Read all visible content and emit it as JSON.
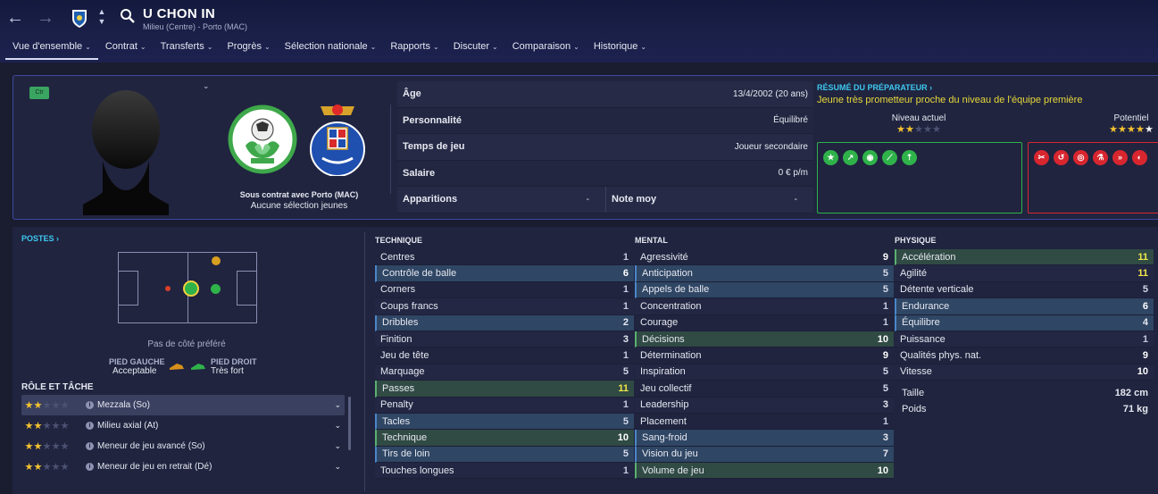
{
  "player": {
    "name": "U CHON IN",
    "subtitle": "Milieu (Centre) - Porto (MAC)"
  },
  "nav": {
    "back": "←",
    "forward": "→"
  },
  "tabs": [
    {
      "label": "Vue d'ensemble",
      "active": true
    },
    {
      "label": "Contrat"
    },
    {
      "label": "Transferts"
    },
    {
      "label": "Progrès"
    },
    {
      "label": "Sélection nationale"
    },
    {
      "label": "Rapports"
    },
    {
      "label": "Discuter"
    },
    {
      "label": "Comparaison"
    },
    {
      "label": "Historique"
    }
  ],
  "overview": {
    "position_badge": "Ctr",
    "contract": "Sous contrat avec Porto (MAC)",
    "youth": "Aucune sélection jeunes",
    "info": {
      "age_label": "Âge",
      "age_value": "13/4/2002 (20 ans)",
      "personality_label": "Personnalité",
      "personality_value": "Équilibré",
      "playtime_label": "Temps de jeu",
      "playtime_value": "Joueur secondaire",
      "salary_label": "Salaire",
      "salary_value": "0 € p/m",
      "apps_label": "Apparitions",
      "apps_value": "-",
      "rating_label": "Note moy",
      "rating_value": "-"
    },
    "coach": {
      "title": "RÉSUMÉ DU PRÉPARATEUR ›",
      "text": "Jeune très prometteur proche du niveau de l'équipe première",
      "current_label": "Niveau actuel",
      "current_stars": 2,
      "potential_label": "Potentiel",
      "potential_stars": 4.5
    },
    "colors": {
      "strengths": "#2fb24a",
      "weaknesses": "#d8262f"
    }
  },
  "lower": {
    "postes_title": "POSTES ›",
    "no_foot_pref": "Pas de côté préféré",
    "left_foot_label": "PIED GAUCHE",
    "left_foot_value": "Acceptable",
    "right_foot_label": "PIED DROIT",
    "right_foot_value": "Très fort",
    "role_title": "RÔLE ET TÂCHE",
    "roles": [
      {
        "label": "Mezzala (So)",
        "stars": 2,
        "selected": true
      },
      {
        "label": "Milieu axial (At)",
        "stars": 2
      },
      {
        "label": "Meneur de jeu avancé (So)",
        "stars": 2
      },
      {
        "label": "Meneur de jeu en retrait (Dé)",
        "stars": 2
      }
    ]
  },
  "attributes": {
    "technique": {
      "title": "TECHNIQUE",
      "items": [
        {
          "name": "Centres",
          "value": 1
        },
        {
          "name": "Contrôle de balle",
          "value": 6,
          "hl": "blue"
        },
        {
          "name": "Corners",
          "value": 1
        },
        {
          "name": "Coups francs",
          "value": 1
        },
        {
          "name": "Dribbles",
          "value": 2,
          "hl": "blue"
        },
        {
          "name": "Finition",
          "value": 3
        },
        {
          "name": "Jeu de tête",
          "value": 1
        },
        {
          "name": "Marquage",
          "value": 5
        },
        {
          "name": "Passes",
          "value": 11,
          "hl": "green"
        },
        {
          "name": "Penalty",
          "value": 1
        },
        {
          "name": "Tacles",
          "value": 5,
          "hl": "blue"
        },
        {
          "name": "Technique",
          "value": 10,
          "hl": "green"
        },
        {
          "name": "Tirs de loin",
          "value": 5,
          "hl": "blue"
        },
        {
          "name": "Touches longues",
          "value": 1
        }
      ]
    },
    "mental": {
      "title": "MENTAL",
      "items": [
        {
          "name": "Agressivité",
          "value": 9
        },
        {
          "name": "Anticipation",
          "value": 5,
          "hl": "blue"
        },
        {
          "name": "Appels de balle",
          "value": 5,
          "hl": "blue"
        },
        {
          "name": "Concentration",
          "value": 1
        },
        {
          "name": "Courage",
          "value": 1
        },
        {
          "name": "Décisions",
          "value": 10,
          "hl": "green"
        },
        {
          "name": "Détermination",
          "value": 9
        },
        {
          "name": "Inspiration",
          "value": 5
        },
        {
          "name": "Jeu collectif",
          "value": 5
        },
        {
          "name": "Leadership",
          "value": 3
        },
        {
          "name": "Placement",
          "value": 1
        },
        {
          "name": "Sang-froid",
          "value": 3,
          "hl": "blue"
        },
        {
          "name": "Vision du jeu",
          "value": 7,
          "hl": "blue"
        },
        {
          "name": "Volume de jeu",
          "value": 10,
          "hl": "green"
        }
      ]
    },
    "physique": {
      "title": "PHYSIQUE",
      "items": [
        {
          "name": "Accélération",
          "value": 11,
          "hl": "green"
        },
        {
          "name": "Agilité",
          "value": 11
        },
        {
          "name": "Détente verticale",
          "value": 5
        },
        {
          "name": "Endurance",
          "value": 6,
          "hl": "blue"
        },
        {
          "name": "Équilibre",
          "value": 4,
          "hl": "blue"
        },
        {
          "name": "Puissance",
          "value": 1
        },
        {
          "name": "Qualités phys. nat.",
          "value": 9
        },
        {
          "name": "Vitesse",
          "value": 10
        }
      ],
      "height_label": "Taille",
      "height_value": "182 cm",
      "weight_label": "Poids",
      "weight_value": "71 kg"
    }
  }
}
